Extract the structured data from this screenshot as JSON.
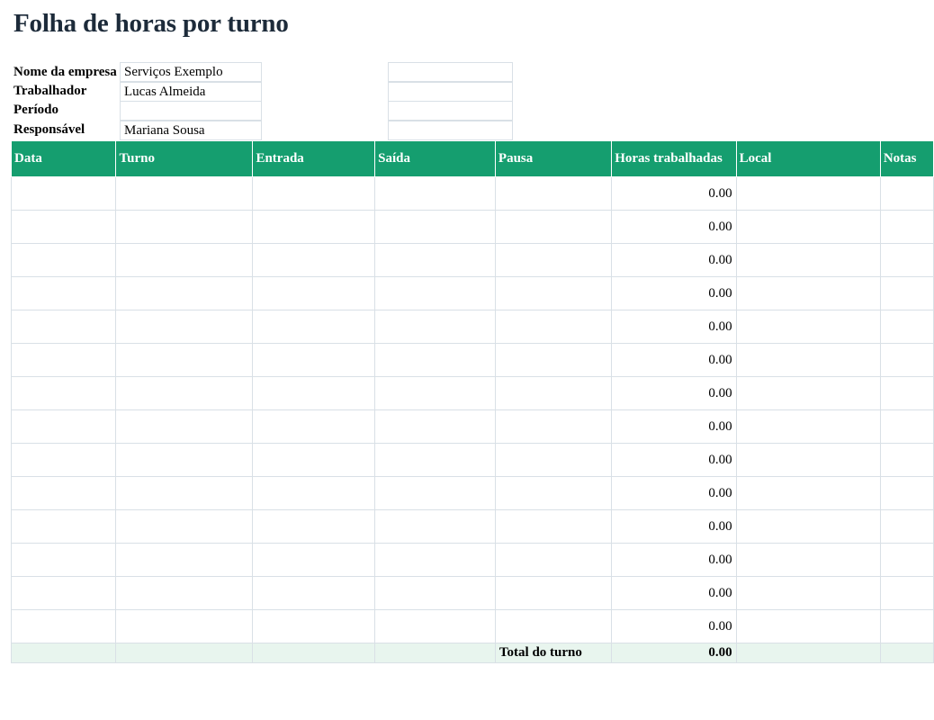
{
  "title": "Folha de horas por turno",
  "info": [
    {
      "label": "Nome da empresa",
      "value": "Serviços Exemplo"
    },
    {
      "label": "Trabalhador",
      "value": "Lucas Almeida"
    },
    {
      "label": "Período",
      "value": ""
    },
    {
      "label": "Responsável",
      "value": "Mariana Sousa"
    }
  ],
  "columns": [
    "Data",
    "Turno",
    "Entrada",
    "Saída",
    "Pausa",
    "Horas trabalhadas",
    "Local",
    "Notas"
  ],
  "rows": [
    {
      "hours": "0.00"
    },
    {
      "hours": "0.00"
    },
    {
      "hours": "0.00"
    },
    {
      "hours": "0.00"
    },
    {
      "hours": "0.00"
    },
    {
      "hours": "0.00"
    },
    {
      "hours": "0.00"
    },
    {
      "hours": "0.00"
    },
    {
      "hours": "0.00"
    },
    {
      "hours": "0.00"
    },
    {
      "hours": "0.00"
    },
    {
      "hours": "0.00"
    },
    {
      "hours": "0.00"
    },
    {
      "hours": "0.00"
    }
  ],
  "total": {
    "label": "Total do turno",
    "value": "0.00"
  },
  "colors": {
    "header_bg": "#159e6f",
    "header_text": "#ffffff",
    "total_bg": "#e8f5ee",
    "title": "#1d2b3a"
  }
}
